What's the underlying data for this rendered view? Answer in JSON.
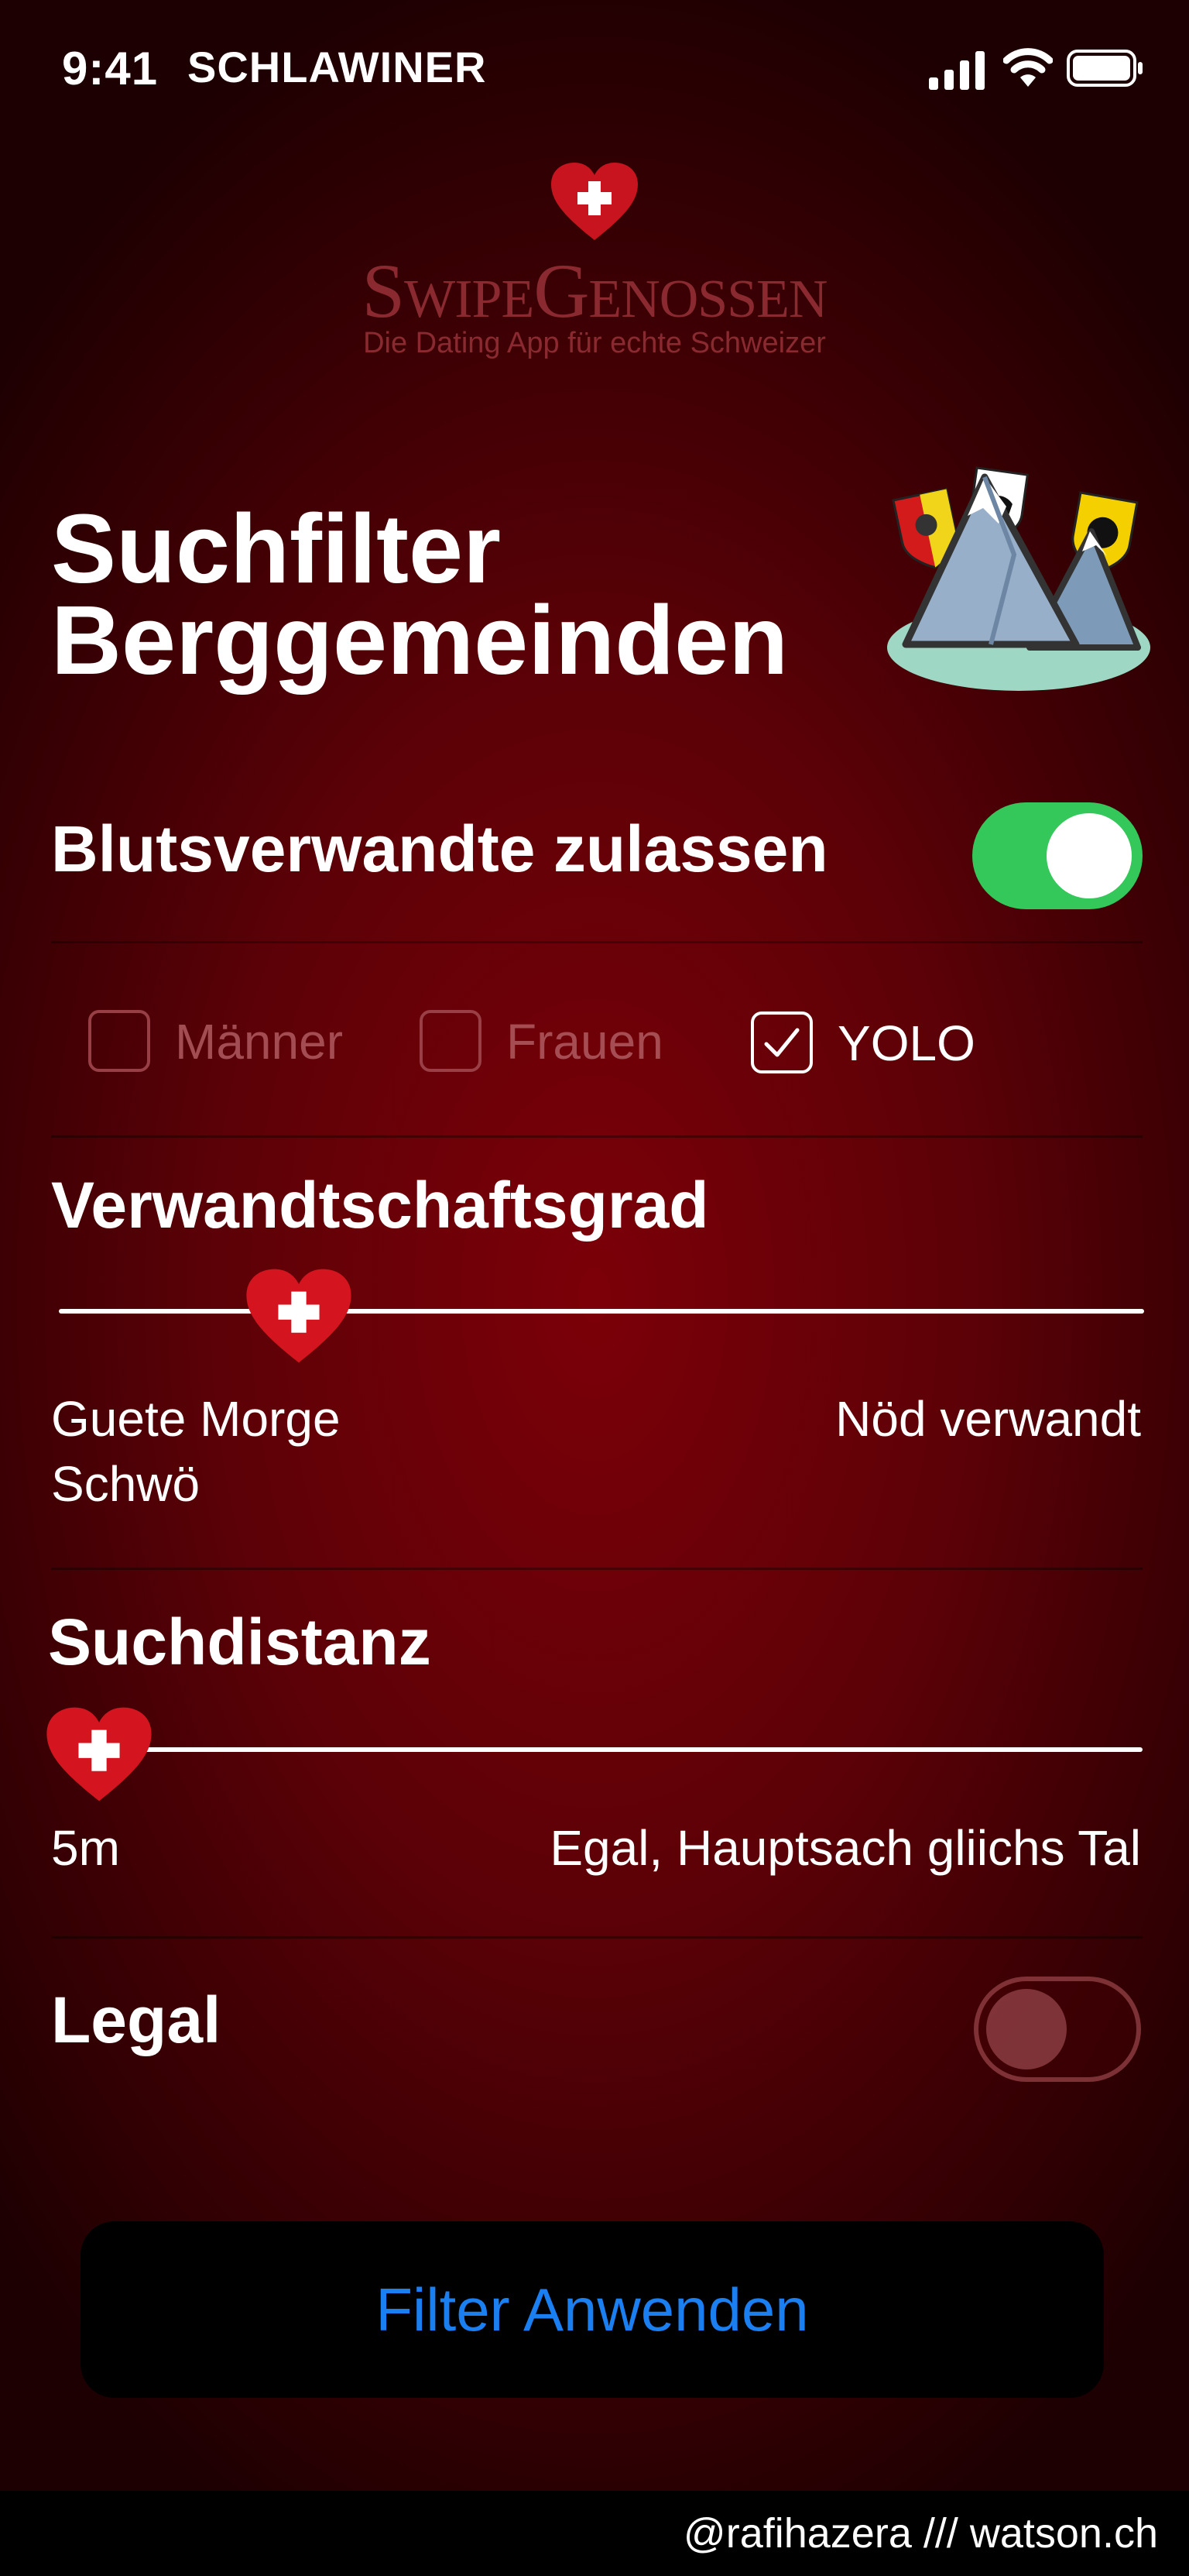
{
  "status_bar": {
    "time": "9:41",
    "carrier": "SCHLAWINER",
    "icons": [
      "cellular-signal-icon",
      "wifi-icon",
      "battery-icon"
    ]
  },
  "logo": {
    "name": "SwipeGenossen",
    "tagline": "Die Dating App für echte Schweizer",
    "icon": "swiss-heart-icon"
  },
  "page": {
    "title_line1": "Suchfilter",
    "title_line2": "Berggemeinden",
    "illustration": "mountains-with-canton-crests"
  },
  "blood_relatives": {
    "label": "Blutsverwandte zulassen",
    "enabled": true,
    "accent": "#34c759"
  },
  "gender_options": [
    {
      "label": "Männer",
      "checked": false
    },
    {
      "label": "Frauen",
      "checked": false
    },
    {
      "label": "YOLO",
      "checked": true
    }
  ],
  "kinship": {
    "heading": "Verwandtschaftsgrad",
    "min_label": "Guete Morge Schwö",
    "max_label": "Nöd verwandt",
    "value_fraction": 0.22
  },
  "distance": {
    "heading": "Suchdistanz",
    "min_label": "5m",
    "max_label": "Egal, Hauptsach gliichs Tal",
    "value_fraction": 0.0
  },
  "legal": {
    "label": "Legal",
    "enabled": false
  },
  "apply_button": {
    "label": "Filter Anwenden",
    "color": "#1a7ff0"
  },
  "credit": "@rafihazera /// watson.ch"
}
